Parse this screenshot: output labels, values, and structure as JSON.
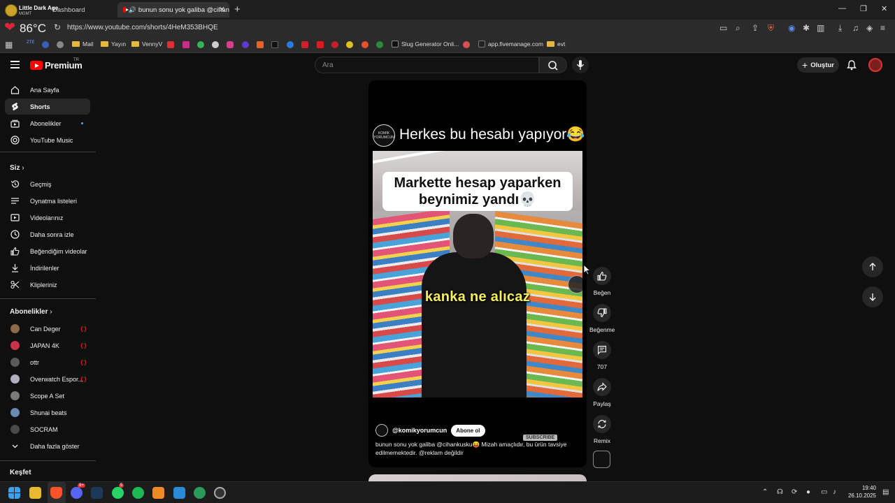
{
  "browser": {
    "profile_name": "Little Dark Age",
    "profile_sub": "MGMT",
    "inactive_tab": "Dashboard",
    "active_tab": "bunun sonu yok galiba @cihan",
    "temperature": "86°C",
    "url": "https://www.youtube.com/shorts/4HeM353BHQE",
    "bookmarks": {
      "mail": "Mail",
      "yayin": "Yayın",
      "vennyv": "VennyV",
      "slug": "Slug Generator Onli...",
      "fivemanage": "app.fivemanage.com",
      "evt": "evt"
    },
    "bookmark_badge": "ZTE"
  },
  "header": {
    "logo_text": "Premium",
    "region": "TR",
    "search_placeholder": "Ara",
    "create_label": "Oluştur"
  },
  "sidebar": {
    "main": [
      {
        "label": "Ana Sayfa"
      },
      {
        "label": "Shorts"
      },
      {
        "label": "Abonelikler"
      },
      {
        "label": "YouTube Music"
      }
    ],
    "you_title": "Siz",
    "you": [
      {
        "label": "Geçmiş"
      },
      {
        "label": "Oynatma listeleri"
      },
      {
        "label": "Videolarınız"
      },
      {
        "label": "Daha sonra izle"
      },
      {
        "label": "Beğendiğim videolar"
      },
      {
        "label": "İndirilenler"
      },
      {
        "label": "Klipleriniz"
      }
    ],
    "subs_title": "Abonelikler",
    "subs": [
      {
        "label": "Can Deger",
        "color": "#8a6a4a",
        "live": true
      },
      {
        "label": "JAPAN 4K",
        "color": "#c8324a",
        "live": true
      },
      {
        "label": "ottr",
        "color": "#5a5a5a",
        "live": true
      },
      {
        "label": "Overwatch Espor...",
        "color": "#b0b0c0",
        "live": true
      },
      {
        "label": "Scope A Set",
        "color": "#7a7a7a",
        "live": false
      },
      {
        "label": "Shunai beats",
        "color": "#6a8ab0",
        "live": false
      },
      {
        "label": "SOCRAM",
        "color": "#4a4a4a",
        "live": false
      }
    ],
    "show_more": "Daha fazla göster",
    "explore_title": "Keşfet"
  },
  "short": {
    "title": "Herkes bu hesabı yapıyor😂",
    "channel_badge": "KOMİK YORUMCUN",
    "caption_line1": "Markette hesap yaparken",
    "caption_line2": "beynimiz yandı💀",
    "subtitle": "kanka ne alıcaz",
    "handle": "@komikyorumcun",
    "subscribe_label": "Abone ol",
    "subscribe_badge": "SUBSCRIBE",
    "description": "bunun sonu yok galiba @cihankusku😝 Mizah amaçlıdır, bu ürün tavsiye edilmemektedir. @reklam değildir"
  },
  "actions": {
    "like": "Beğen",
    "dislike": "Beğenme",
    "comments": "707",
    "share": "Paylaş",
    "remix": "Remix"
  },
  "taskbar": {
    "time": "19:40",
    "date": "26.10.2025",
    "discord_badge": "9+",
    "whatsapp_badge": "5"
  }
}
